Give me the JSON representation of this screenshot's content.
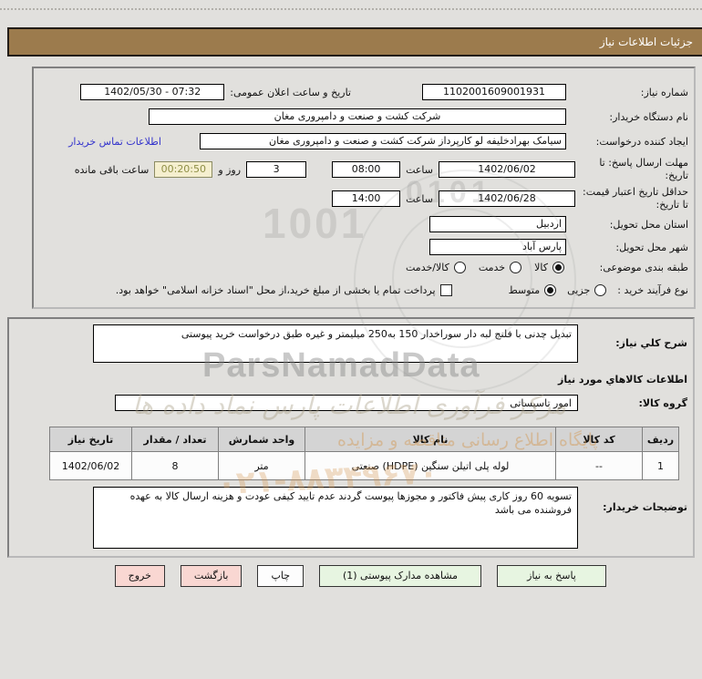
{
  "title_bar": {
    "text": "جزئیات اطلاعات نیاز"
  },
  "colors": {
    "header_bg": "#9c7b4d",
    "button_green": "#e7f5e1",
    "button_pink": "#f9d7d2",
    "remaining_bg": "#f5efcf",
    "link_blue": "#3333cc"
  },
  "panel1": {
    "need_number": {
      "label": "شماره نیاز:",
      "value": "1102001609001931"
    },
    "announce": {
      "label": "تاریخ و ساعت اعلان عمومی:",
      "value": "07:32 - 1402/05/30"
    },
    "buyer_org": {
      "label": "نام دستگاه خریدار:",
      "value": "شرکت کشت و صنعت و دامپروری مغان"
    },
    "creator": {
      "label": "ایجاد کننده درخواست:",
      "value": "سیامک بهرادخلیفه لو کارپرداز شرکت کشت و صنعت و دامپروری مغان",
      "contact_link": "اطلاعات تماس خریدار"
    },
    "reply_deadline": {
      "label": "مهلت ارسال پاسخ: تا تاریخ:",
      "date": "1402/06/02",
      "hour_label": "ساعت",
      "time": "08:00",
      "days": "3",
      "days_label": "روز و",
      "remaining": "00:20:50",
      "remaining_label": "ساعت باقی مانده"
    },
    "price_validity": {
      "label": "حداقل تاریخ اعتبار قیمت: تا تاریخ:",
      "date": "1402/06/28",
      "hour_label": "ساعت",
      "time": "14:00"
    },
    "province": {
      "label": "استان محل تحویل:",
      "value": "اردبیل"
    },
    "city": {
      "label": "شهر محل تحویل:",
      "value": "پارس آباد"
    },
    "classification": {
      "label": "طبقه بندی موضوعی:",
      "options": [
        "کالا",
        "خدمت",
        "کالا/خدمت"
      ],
      "selected": "کالا"
    },
    "process_type": {
      "label": "نوع فرآیند خرید :",
      "options": [
        "جزیی",
        "متوسط"
      ],
      "selected": "متوسط",
      "checkbox_label": "پرداخت تمام یا بخشی از مبلغ خرید،از محل \"اسناد خزانه اسلامی\" خواهد بود.",
      "checkbox_checked": false
    }
  },
  "panel2": {
    "need_description": {
      "label": "شرح کلي نياز:",
      "value": "تبدیل چدنی با فلنج لبه دار سوراخدار 150 به250 میلیمتر و غیره طبق درخواست خرید پیوستی"
    },
    "goods_section_title": "اطلاعات كالاهاي مورد نياز",
    "goods_group": {
      "label": "گروه کالا:",
      "value": "امور تاسیساتی"
    },
    "table": {
      "headers": [
        "ردیف",
        "کد کالا",
        "نام کالا",
        "واحد شمارش",
        "تعداد / مقدار",
        "تاریخ نیاز"
      ],
      "rows": [
        [
          "1",
          "--",
          "لوله پلی اتیلن سنگین (HDPE) صنعتی",
          "متر",
          "8",
          "1402/06/02"
        ]
      ]
    },
    "buyer_notes": {
      "label": "توضيحات خريدار:",
      "value": "تسویه 60 روز کاری پیش فاکتور و مجوزها پیوست گردند عدم تایید کیفی عودت و هزینه ارسال کالا به عهده فروشنده می باشد"
    }
  },
  "buttons": {
    "respond": "پاسخ به نیاز",
    "view_docs": "مشاهده مدارک پیوستی (1)",
    "print": "چاپ",
    "back": "بازگشت",
    "exit": "خروج"
  },
  "watermarks": {
    "brand": "ParsNamadData",
    "calligraphy": "مرکز فرآوری اطلاعات پارس نماد داده ها",
    "tagline": "پایگاه اطلاع رسانی مناقصه و مزایده",
    "phone": "۰۲۱-۸۸۳۴۹۶۷۰",
    "digits_a": "0101",
    "digits_b": "1001"
  }
}
